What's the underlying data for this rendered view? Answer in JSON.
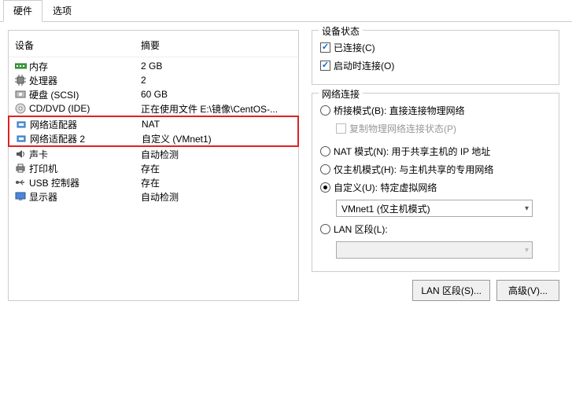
{
  "tabs": [
    {
      "label": "硬件",
      "active": true
    },
    {
      "label": "选项",
      "active": false
    }
  ],
  "list_header": {
    "device": "设备",
    "summary": "摘要"
  },
  "devices": [
    {
      "name": "内存",
      "summary": "2 GB",
      "icon": "memory"
    },
    {
      "name": "处理器",
      "summary": "2",
      "icon": "cpu"
    },
    {
      "name": "硬盘 (SCSI)",
      "summary": "60 GB",
      "icon": "disk"
    },
    {
      "name": "CD/DVD (IDE)",
      "summary": "正在使用文件 E:\\镜像\\CentOS-...",
      "icon": "cd"
    },
    {
      "name": "网络适配器",
      "summary": "NAT",
      "icon": "net"
    },
    {
      "name": "网络适配器 2",
      "summary": "自定义 (VMnet1)",
      "icon": "net"
    },
    {
      "name": "声卡",
      "summary": "自动检测",
      "icon": "sound"
    },
    {
      "name": "打印机",
      "summary": "存在",
      "icon": "printer"
    },
    {
      "name": "USB 控制器",
      "summary": "存在",
      "icon": "usb"
    },
    {
      "name": "显示器",
      "summary": "自动检测",
      "icon": "display"
    }
  ],
  "status": {
    "title": "设备状态",
    "connected": "已连接(C)",
    "connect_at_power": "启动时连接(O)"
  },
  "network": {
    "title": "网络连接",
    "bridge": "桥接模式(B): 直接连接物理网络",
    "replicate": "复制物理网络连接状态(P)",
    "nat": "NAT 模式(N): 用于共享主机的 IP 地址",
    "hostonly": "仅主机模式(H): 与主机共享的专用网络",
    "custom": "自定义(U): 特定虚拟网络",
    "custom_value": "VMnet1 (仅主机模式)",
    "lan": "LAN 区段(L):"
  },
  "buttons": {
    "lan_segment": "LAN 区段(S)...",
    "advanced": "高级(V)..."
  }
}
